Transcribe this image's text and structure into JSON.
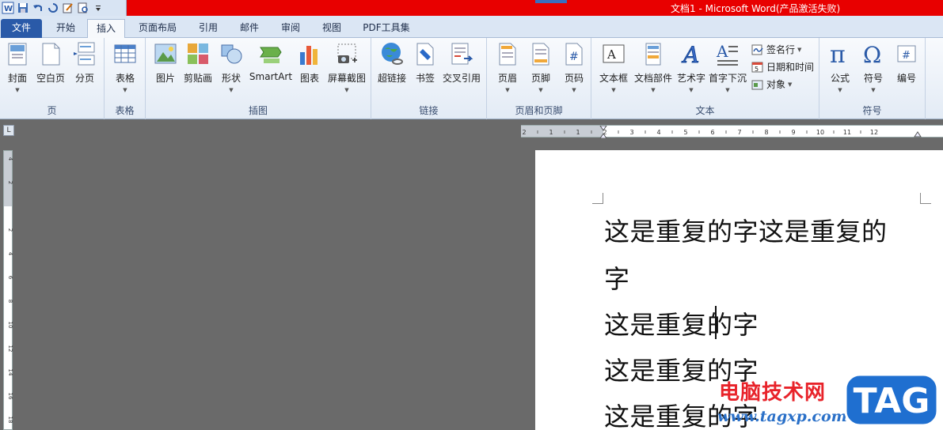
{
  "window": {
    "title": "文档1 - Microsoft Word(产品激活失败)"
  },
  "tabs": [
    {
      "label": "文件"
    },
    {
      "label": "开始"
    },
    {
      "label": "插入"
    },
    {
      "label": "页面布局"
    },
    {
      "label": "引用"
    },
    {
      "label": "邮件"
    },
    {
      "label": "审阅"
    },
    {
      "label": "视图"
    },
    {
      "label": "PDF工具集"
    }
  ],
  "ribbon": {
    "groups": {
      "pages": {
        "label": "页",
        "buttons": [
          "封面",
          "空白页",
          "分页"
        ]
      },
      "tables": {
        "label": "表格",
        "buttons": [
          "表格"
        ]
      },
      "illustrations": {
        "label": "插图",
        "buttons": [
          "图片",
          "剪贴画",
          "形状",
          "SmartArt",
          "图表",
          "屏幕截图"
        ]
      },
      "links": {
        "label": "链接",
        "buttons": [
          "超链接",
          "书签",
          "交叉引用"
        ]
      },
      "header_footer": {
        "label": "页眉和页脚",
        "buttons": [
          "页眉",
          "页脚",
          "页码"
        ]
      },
      "text": {
        "label": "文本",
        "buttons": [
          "文本框",
          "文档部件",
          "艺术字",
          "首字下沉"
        ],
        "small_buttons": [
          "签名行",
          "日期和时间",
          "对象"
        ]
      },
      "symbols": {
        "label": "符号",
        "buttons": [
          "公式",
          "符号",
          "编号"
        ]
      }
    }
  },
  "ruler": {
    "h_ticks": [
      "2",
      "1",
      "1",
      "2",
      "3",
      "4",
      "5",
      "6",
      "7",
      "8",
      "9",
      "10",
      "11",
      "12"
    ],
    "v_ticks": [
      "4",
      "2",
      "2",
      "4",
      "6",
      "8",
      "10",
      "12",
      "14",
      "16",
      "18"
    ],
    "corner": "L"
  },
  "document": {
    "lines": [
      "这是重复的字这是重复的",
      "字",
      "这是重复的字",
      "这是重复的字",
      "这是重复的字"
    ]
  },
  "watermark": {
    "text": "电脑技术网",
    "url": "www.tagxp.com",
    "badge": "TAG"
  }
}
